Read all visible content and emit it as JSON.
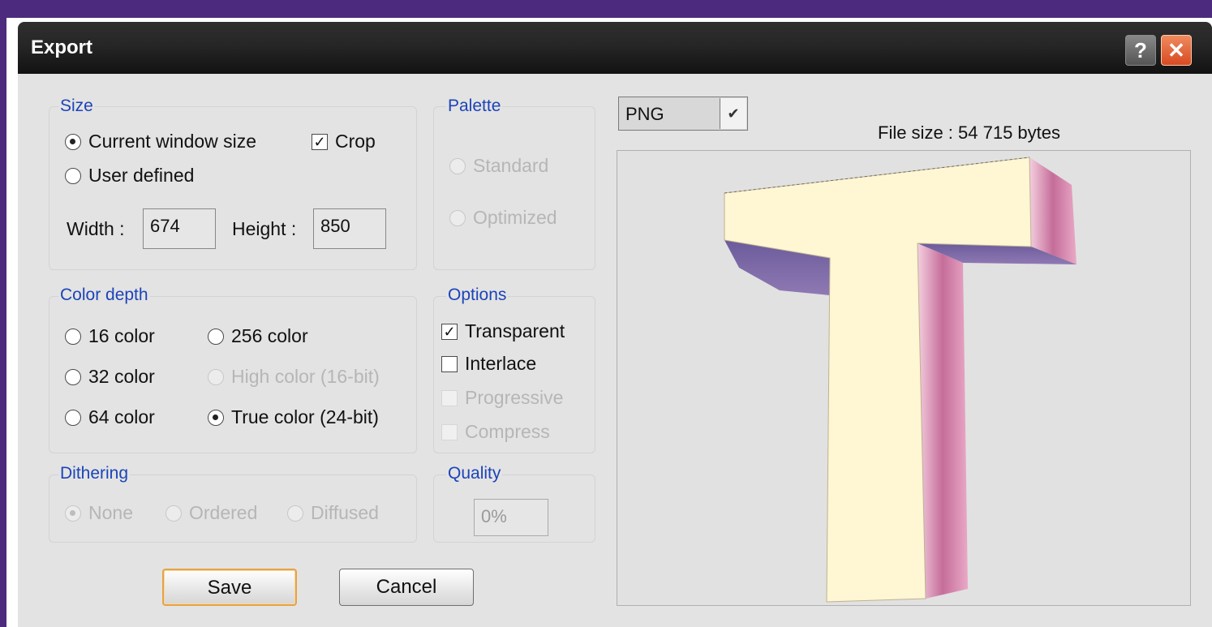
{
  "window": {
    "title": "Export"
  },
  "titlebar_buttons": {
    "help": "?",
    "close": "✕"
  },
  "size": {
    "label": "Size",
    "current_window_size": "Current window size",
    "user_defined": "User defined",
    "crop": "Crop",
    "crop_checked": true,
    "width_label": "Width :",
    "width_value": "674",
    "height_label": "Height :",
    "height_value": "850"
  },
  "palette": {
    "label": "Palette",
    "standard": "Standard",
    "optimized": "Optimized"
  },
  "color_depth": {
    "label": "Color depth",
    "c16": "16 color",
    "c32": "32 color",
    "c64": "64 color",
    "c256": "256 color",
    "high": "High color (16-bit)",
    "true": "True color (24-bit)",
    "selected": "True color (24-bit)"
  },
  "options": {
    "label": "Options",
    "transparent": "Transparent",
    "transparent_checked": true,
    "interlace": "Interlace",
    "progressive": "Progressive",
    "compress": "Compress"
  },
  "dithering": {
    "label": "Dithering",
    "none": "None",
    "ordered": "Ordered",
    "diffused": "Diffused"
  },
  "quality": {
    "label": "Quality",
    "value": "0%"
  },
  "format": {
    "selected": "PNG"
  },
  "file_size": "File size : 54 715 bytes",
  "buttons": {
    "save": "Save",
    "cancel": "Cancel"
  },
  "colors": {
    "accent_label": "#1c44b8",
    "close_button": "#d84a22",
    "letter_face": "#fff6d4",
    "letter_side": "#c98fb0"
  },
  "preview": {
    "icon": "3d-letter-t-preview"
  }
}
